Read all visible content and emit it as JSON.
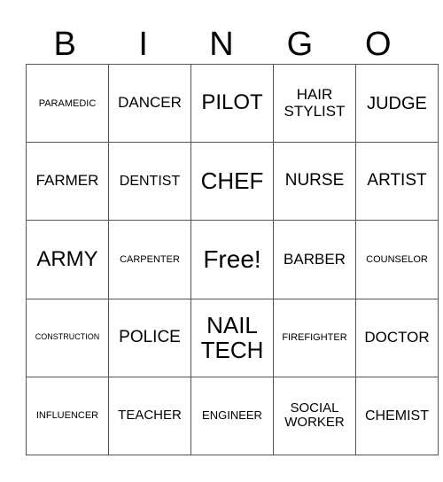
{
  "header": [
    "B",
    "I",
    "N",
    "G",
    "O"
  ],
  "grid": [
    [
      "PARAMEDIC",
      "DANCER",
      "PILOT",
      "HAIR STYLIST",
      "JUDGE"
    ],
    [
      "FARMER",
      "DENTIST",
      "CHEF",
      "NURSE",
      "ARTIST"
    ],
    [
      "ARMY",
      "CARPENTER",
      "Free!",
      "BARBER",
      "COUNSELOR"
    ],
    [
      "CONSTRUCTION",
      "POLICE",
      "NAIL TECH",
      "FIREFIGHTER",
      "DOCTOR"
    ],
    [
      "INFLUENCER",
      "TEACHER",
      "ENGINEER",
      "SOCIAL WORKER",
      "CHEMIST"
    ]
  ]
}
